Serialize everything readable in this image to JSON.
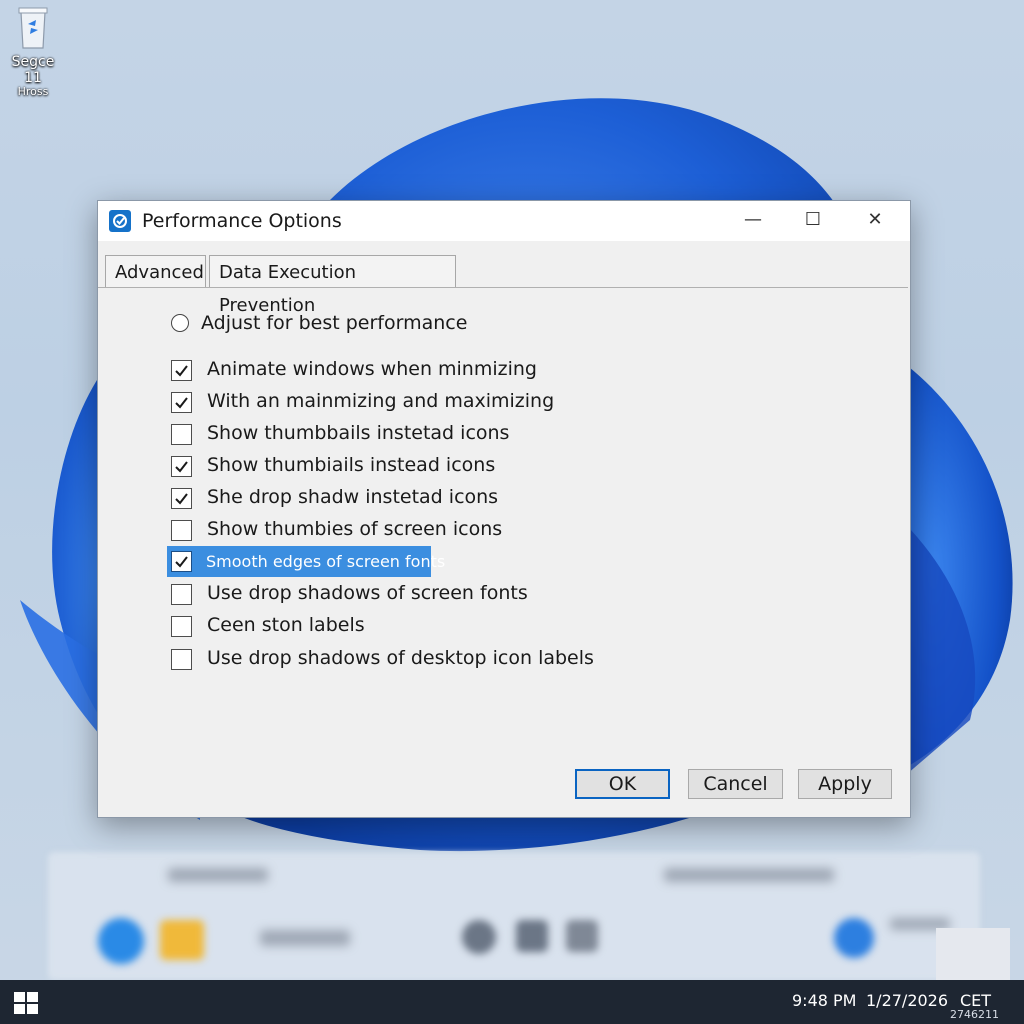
{
  "desktop": {
    "icon_label_line1": "Segce 11",
    "icon_label_line2": "Hross"
  },
  "dialog": {
    "title": "Performance Options",
    "window_buttons": {
      "minimize": "—",
      "maximize": "☐",
      "close": "✕"
    },
    "tabs": [
      {
        "label": "Advanced"
      },
      {
        "label": "Data Execution Prevention"
      }
    ],
    "radio": {
      "label": "Adjust for best performance",
      "selected": false
    },
    "options": [
      {
        "label": "Animate windows when minmizing",
        "checked": true
      },
      {
        "label": "With an mainmizing and maximizing",
        "checked": true
      },
      {
        "label": "Show thumbbails instetad icons",
        "checked": false
      },
      {
        "label": "Show thumbiails instead icons",
        "checked": true
      },
      {
        "label": "She drop shadw instetad icons",
        "checked": true
      },
      {
        "label": "Show thumbies of screen icons",
        "checked": false
      },
      {
        "label": "Smooth edges of screen fonts",
        "checked": true,
        "selected": true
      },
      {
        "label": "Use drop shadows of screen fonts",
        "checked": false
      },
      {
        "label": "Ceen ston labels",
        "checked": false
      },
      {
        "label": "Use drop shadows of desktop icon labels",
        "checked": false
      }
    ],
    "buttons": {
      "ok": "OK",
      "cancel": "Cancel",
      "apply": "Apply"
    }
  },
  "taskbar": {
    "time": "9:48 PM",
    "date": "1/27/2026",
    "timezone": "CET",
    "tray_sub": "2746211"
  },
  "colors": {
    "accent": "#0a64c2",
    "selection": "#3b8ee0",
    "wallpaper_blue": "#1a5fd6",
    "taskbar": "#1e2632"
  }
}
